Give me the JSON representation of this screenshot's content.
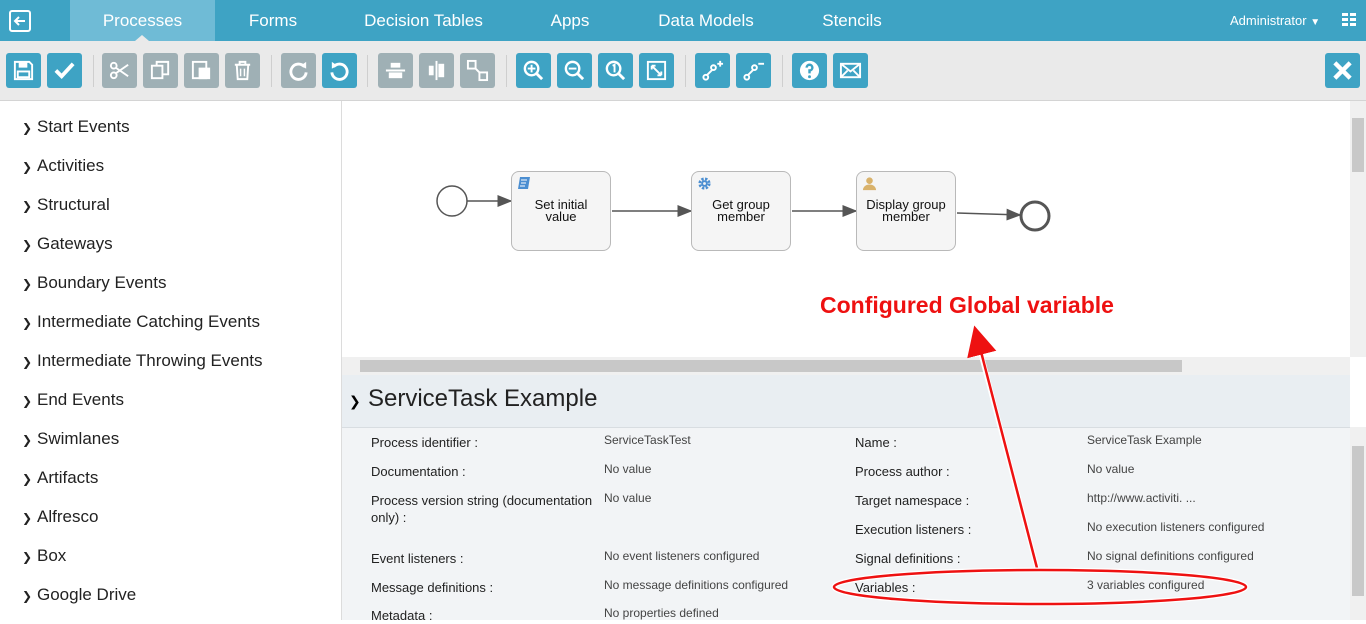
{
  "nav": {
    "tabs": [
      "Processes",
      "Forms",
      "Decision Tables",
      "Apps",
      "Data Models",
      "Stencils"
    ],
    "user": "Administrator",
    "accent": "#3ea3c4"
  },
  "toolbar": {
    "icons": [
      "save-icon",
      "validate-icon",
      "cut-icon",
      "copy-icon",
      "paste-icon",
      "delete-icon",
      "redo-icon",
      "undo-icon",
      "align-horizontal-icon",
      "align-vertical-icon",
      "same-size-icon",
      "zoom-in-icon",
      "zoom-out-icon",
      "zoom-actual-icon",
      "zoom-fit-icon",
      "bend-point-add-icon",
      "bend-point-remove-icon",
      "help-icon",
      "feedback-icon",
      "close-icon"
    ]
  },
  "palette": {
    "items": [
      "Start Events",
      "Activities",
      "Structural",
      "Gateways",
      "Boundary Events",
      "Intermediate Catching Events",
      "Intermediate Throwing Events",
      "End Events",
      "Swimlanes",
      "Artifacts",
      "Alfresco",
      "Box",
      "Google Drive"
    ]
  },
  "canvas": {
    "tasks": [
      "Set initial value",
      "Get group member",
      "Display group member"
    ],
    "annotation": "Configured Global variable"
  },
  "properties": {
    "title": "ServiceTask Example",
    "left": [
      {
        "label": "Process identifier :",
        "value": "ServiceTaskTest"
      },
      {
        "label": "Documentation :",
        "value": "No value"
      },
      {
        "label": "Process version string (documentation only) :",
        "value": "No value"
      },
      {
        "label": "Event listeners :",
        "value": "No event listeners configured"
      },
      {
        "label": "Message definitions :",
        "value": "No message definitions configured"
      },
      {
        "label": "Metadata :",
        "value": "No properties defined"
      }
    ],
    "right": [
      {
        "label": "Name :",
        "value": "ServiceTask Example"
      },
      {
        "label": "Process author :",
        "value": "No value"
      },
      {
        "label": "Target namespace :",
        "value": "http://www.activiti. ..."
      },
      {
        "label": "Execution listeners :",
        "value": "No execution listeners configured"
      },
      {
        "label": "Signal definitions :",
        "value": "No signal definitions configured"
      },
      {
        "label": "Variables :",
        "value": "3 variables configured"
      }
    ]
  }
}
